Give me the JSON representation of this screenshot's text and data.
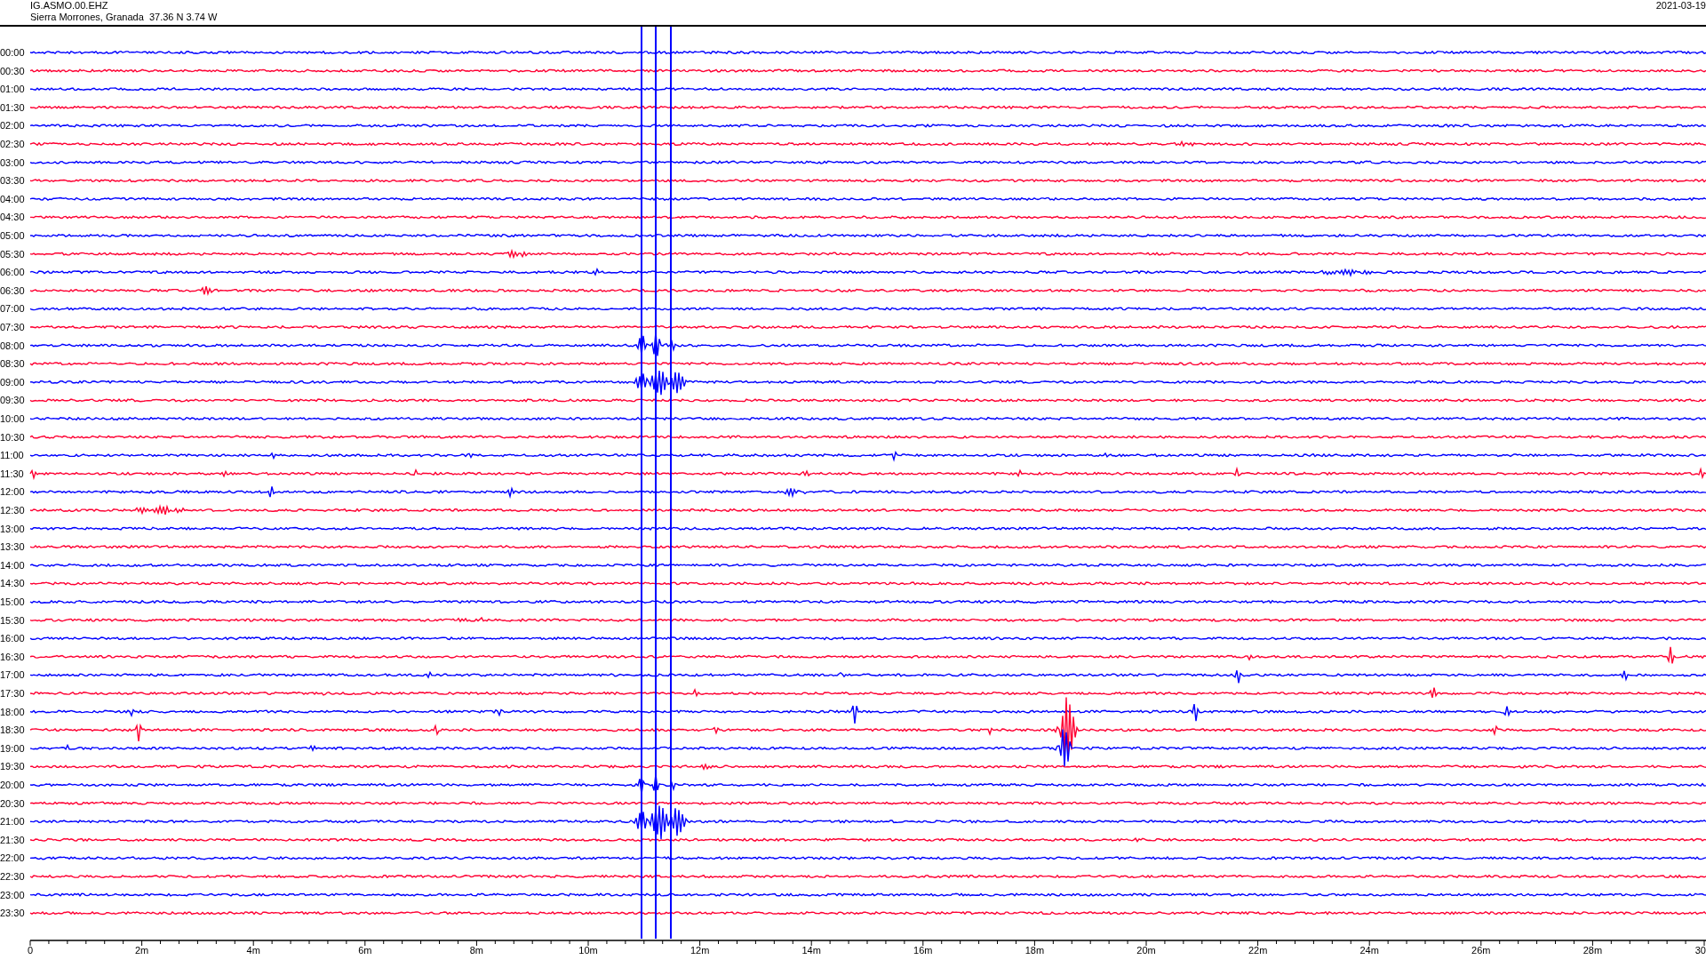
{
  "header": {
    "station": "IG.ASMO.00.EHZ",
    "location": "Sierra Morrones, Granada  37.36 N 3.74 W",
    "date": "2021-03-19"
  },
  "rows": [
    {
      "time": "00:00",
      "color": "#0000ff"
    },
    {
      "time": "00:30",
      "color": "#ff0033"
    },
    {
      "time": "01:00",
      "color": "#0000ff"
    },
    {
      "time": "01:30",
      "color": "#ff0033"
    },
    {
      "time": "02:00",
      "color": "#0000ff"
    },
    {
      "time": "02:30",
      "color": "#ff0033"
    },
    {
      "time": "03:00",
      "color": "#0000ff"
    },
    {
      "time": "03:30",
      "color": "#ff0033"
    },
    {
      "time": "04:00",
      "color": "#0000ff"
    },
    {
      "time": "04:30",
      "color": "#ff0033"
    },
    {
      "time": "05:00",
      "color": "#0000ff"
    },
    {
      "time": "05:30",
      "color": "#ff0033"
    },
    {
      "time": "06:00",
      "color": "#0000ff"
    },
    {
      "time": "06:30",
      "color": "#ff0033"
    },
    {
      "time": "07:00",
      "color": "#0000ff"
    },
    {
      "time": "07:30",
      "color": "#ff0033"
    },
    {
      "time": "08:00",
      "color": "#0000ff"
    },
    {
      "time": "08:30",
      "color": "#ff0033"
    },
    {
      "time": "09:00",
      "color": "#0000ff"
    },
    {
      "time": "09:30",
      "color": "#ff0033"
    },
    {
      "time": "10:00",
      "color": "#0000ff"
    },
    {
      "time": "10:30",
      "color": "#ff0033"
    },
    {
      "time": "11:00",
      "color": "#0000ff"
    },
    {
      "time": "11:30",
      "color": "#ff0033"
    },
    {
      "time": "12:00",
      "color": "#0000ff"
    },
    {
      "time": "12:30",
      "color": "#ff0033"
    },
    {
      "time": "13:00",
      "color": "#0000ff"
    },
    {
      "time": "13:30",
      "color": "#ff0033"
    },
    {
      "time": "14:00",
      "color": "#0000ff"
    },
    {
      "time": "14:30",
      "color": "#ff0033"
    },
    {
      "time": "15:00",
      "color": "#0000ff"
    },
    {
      "time": "15:30",
      "color": "#ff0033"
    },
    {
      "time": "16:00",
      "color": "#0000ff"
    },
    {
      "time": "16:30",
      "color": "#ff0033"
    },
    {
      "time": "17:00",
      "color": "#0000ff"
    },
    {
      "time": "17:30",
      "color": "#ff0033"
    },
    {
      "time": "18:00",
      "color": "#0000ff"
    },
    {
      "time": "18:30",
      "color": "#ff0033"
    },
    {
      "time": "19:00",
      "color": "#0000ff"
    },
    {
      "time": "19:30",
      "color": "#ff0033"
    },
    {
      "time": "20:00",
      "color": "#0000ff"
    },
    {
      "time": "20:30",
      "color": "#ff0033"
    },
    {
      "time": "21:00",
      "color": "#0000ff"
    },
    {
      "time": "21:30",
      "color": "#ff0033"
    },
    {
      "time": "22:00",
      "color": "#0000ff"
    },
    {
      "time": "22:30",
      "color": "#ff0033"
    },
    {
      "time": "23:00",
      "color": "#0000ff"
    },
    {
      "time": "23:30",
      "color": "#ff0033"
    }
  ],
  "x_axis": [
    "0",
    "2m",
    "4m",
    "6m",
    "8m",
    "10m",
    "12m",
    "14m",
    "16m",
    "18m",
    "20m",
    "22m",
    "24m",
    "26m",
    "28m",
    "30"
  ]
}
